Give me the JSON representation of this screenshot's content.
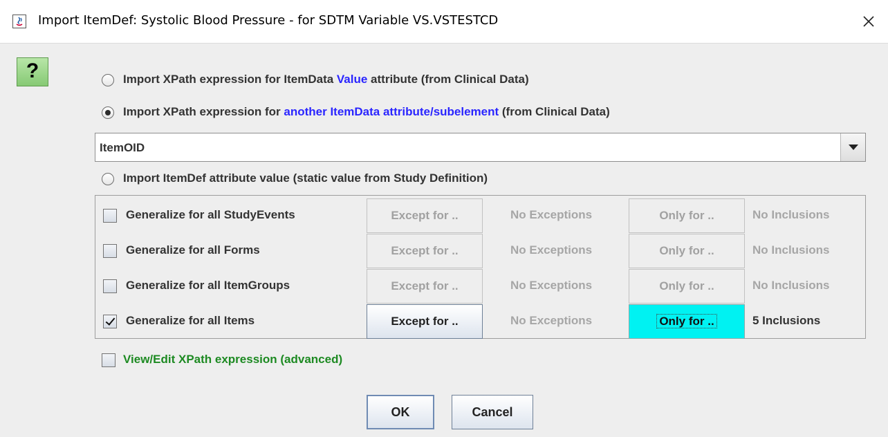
{
  "window": {
    "title": "Import ItemDef: Systolic Blood Pressure - for SDTM Variable VS.VSTESTCD",
    "app_icon": "java-icon",
    "close_icon": "close-icon"
  },
  "help_button": {
    "label": "?"
  },
  "options": [
    {
      "prefix": "Import XPath expression for ItemData ",
      "highlight": "Value",
      "suffix": " attribute (from Clinical Data)",
      "selected": false
    },
    {
      "prefix": "Import XPath expression for ",
      "highlight": "another ItemData attribute/subelement",
      "suffix": " (from Clinical Data)",
      "selected": true
    },
    {
      "text": "Import ItemDef attribute value (static value from Study Definition)",
      "selected": false
    }
  ],
  "attribute_select": {
    "value": "ItemOID"
  },
  "generalize_rows": [
    {
      "label": "Generalize for all StudyEvents",
      "checked": false,
      "except_label": "Except for ..",
      "exceptions": "No Exceptions",
      "only_label": "Only for ..",
      "inclusions": "No Inclusions"
    },
    {
      "label": "Generalize for all Forms",
      "checked": false,
      "except_label": "Except for ..",
      "exceptions": "No Exceptions",
      "only_label": "Only for ..",
      "inclusions": "No Inclusions"
    },
    {
      "label": "Generalize for all ItemGroups",
      "checked": false,
      "except_label": "Except for ..",
      "exceptions": "No Exceptions",
      "only_label": "Only for ..",
      "inclusions": "No Inclusions"
    },
    {
      "label": "Generalize for all Items",
      "checked": true,
      "except_label": "Except for ..",
      "exceptions": "No Exceptions",
      "only_label": "Only for ..",
      "inclusions": "5 Inclusions"
    }
  ],
  "advanced": {
    "label": "View/Edit XPath expression (advanced)",
    "checked": false
  },
  "buttons": {
    "ok": "OK",
    "cancel": "Cancel"
  },
  "colors": {
    "highlight_blue": "#2a25ff",
    "advanced_green": "#1d8a22",
    "only_for_active": "#00f2f2",
    "help_green": "#86c974"
  }
}
